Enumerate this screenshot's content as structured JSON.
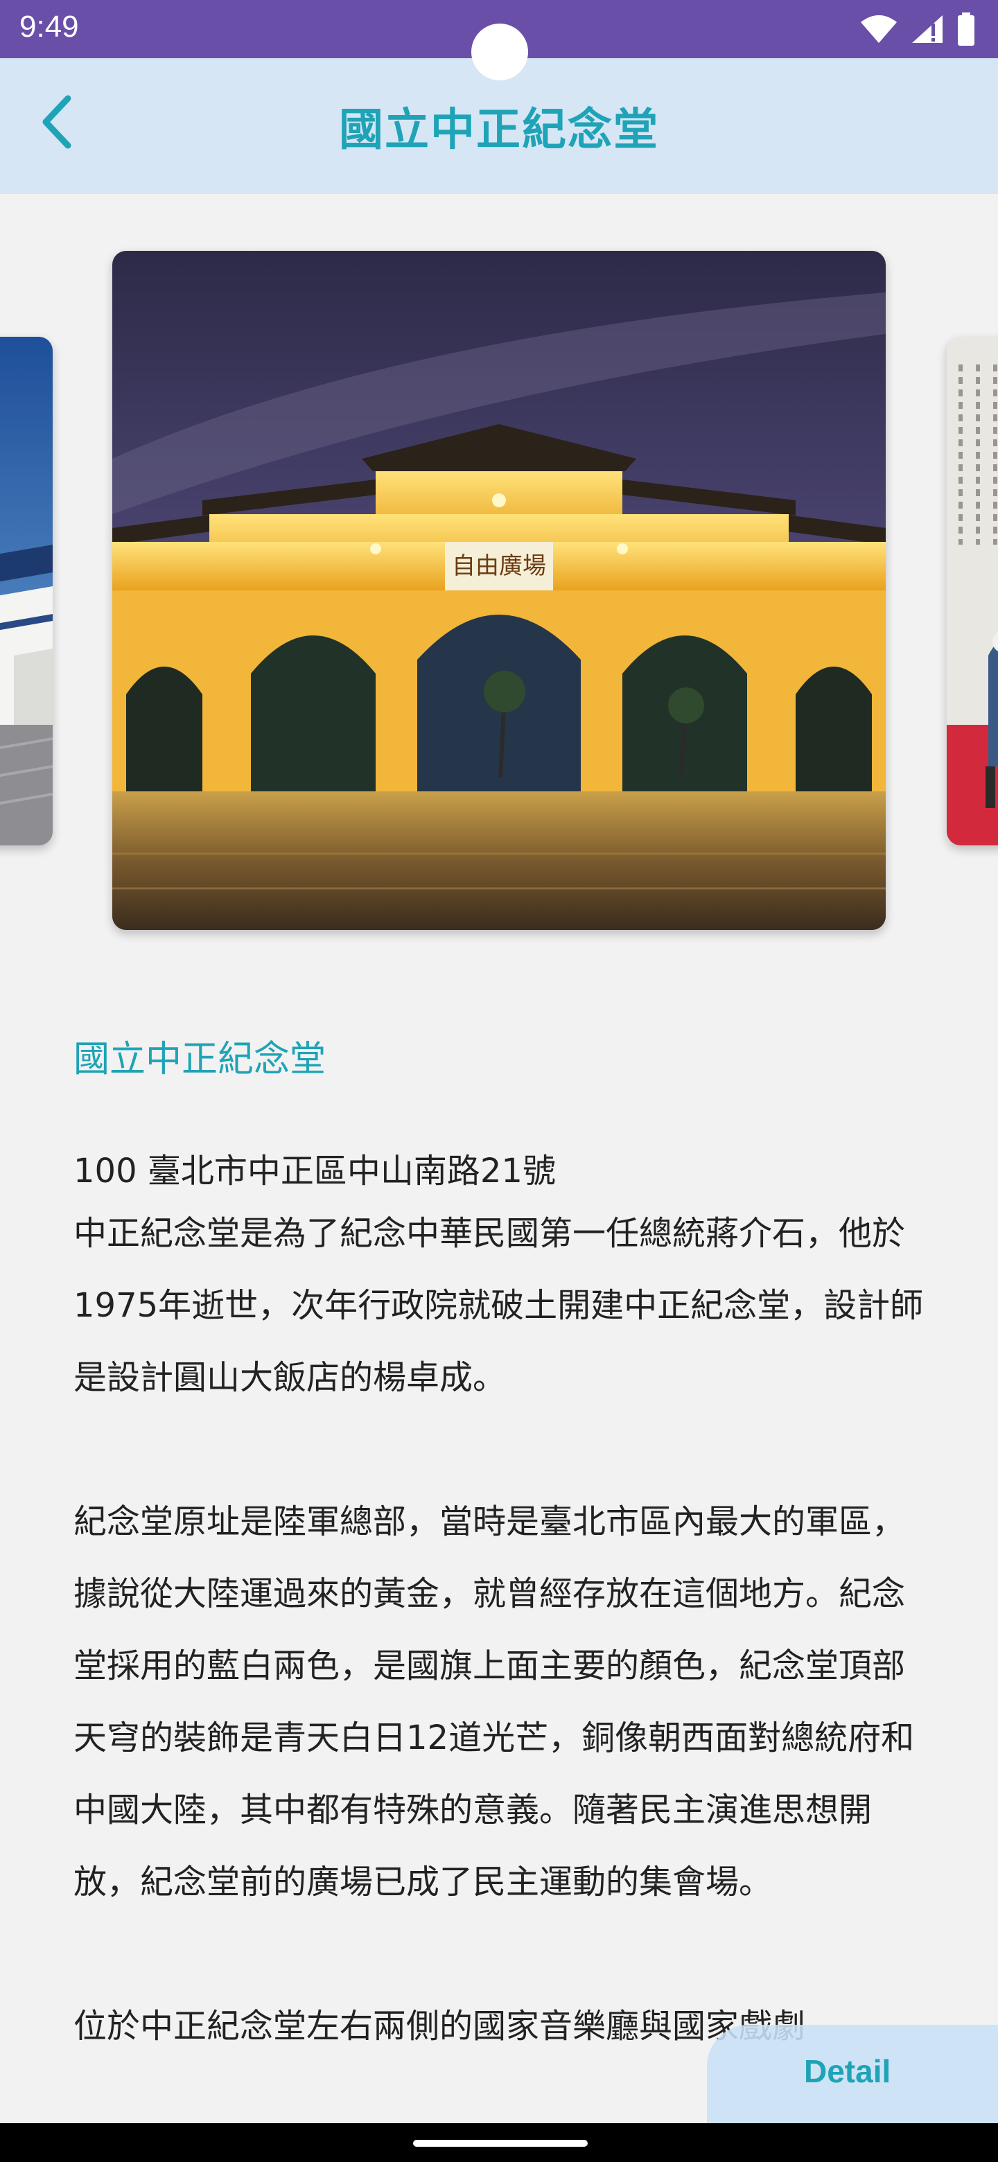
{
  "status_bar": {
    "time": "9:49",
    "icons": [
      "wifi-icon",
      "signal-icon",
      "battery-icon"
    ]
  },
  "app_bar": {
    "title": "國立中正紀念堂",
    "back_icon": "chevron-left-icon"
  },
  "carousel": {
    "images": [
      {
        "name": "memorial-hall-blue-sky"
      },
      {
        "name": "liberty-square-gate-night"
      },
      {
        "name": "honor-guard-ceremony"
      }
    ]
  },
  "content": {
    "place_name": "國立中正紀念堂",
    "address": "100 臺北市中正區中山南路21號",
    "paragraphs": [
      "中正紀念堂是為了紀念中華民國第一任總統蔣介石，他於1975年逝世，次年行政院就破土開建中正紀念堂，設計師是設計圓山大飯店的楊卓成。",
      "紀念堂原址是陸軍總部，當時是臺北市區內最大的軍區，據說從大陸運過來的黃金，就曾經存放在這個地方。紀念堂採用的藍白兩色，是國旗上面主要的顏色，紀念堂頂部天穹的裝飾是青天白日12道光芒，銅像朝西面對總統府和中國大陸，其中都有特殊的意義。隨著民主演進思想開放，紀念堂前的廣場已成了民主運動的集會場。",
      "位於中正紀念堂左右兩側的國家音樂廳與國家戲劇"
    ]
  },
  "detail_button": {
    "label": "Detail"
  },
  "colors": {
    "status_bar": "#6a4fa8",
    "app_bar": "#d6e6f5",
    "accent": "#1fa3b6",
    "background": "#f2f2f2"
  }
}
